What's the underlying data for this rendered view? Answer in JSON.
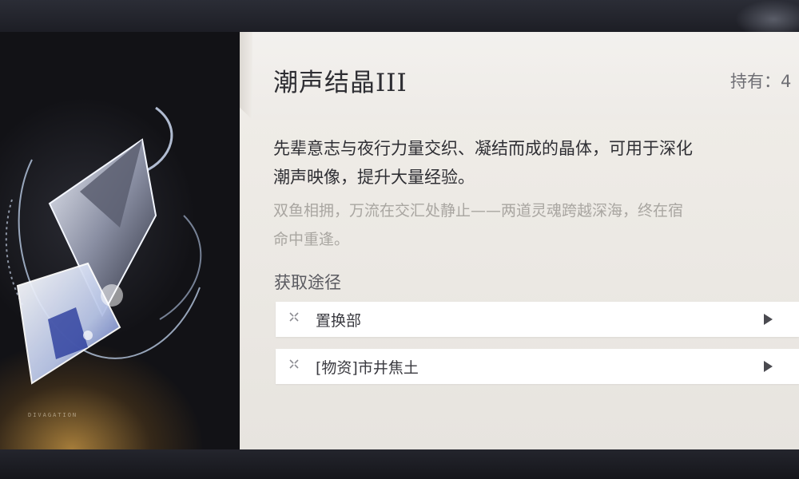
{
  "item": {
    "name": "潮声结晶III",
    "owned_label": "持有：4"
  },
  "description": {
    "line1": "先辈意志与夜行力量交织、凝结而成的晶体，可用于深化",
    "line2": "潮声映像，提升大量经验。"
  },
  "flavor": {
    "line1": "双鱼相拥，万流在交汇处静止——两道灵魂跨越深海，终在宿",
    "line2": "命中重逢。"
  },
  "acquire": {
    "heading": "获取途径",
    "routes": [
      {
        "label": "置换部",
        "icon": "source-marker-icon"
      },
      {
        "label": "[物资]市井焦土",
        "icon": "source-marker-icon"
      }
    ]
  },
  "art": {
    "logo_text": "DIVAGATION"
  },
  "colors": {
    "panel_bg": "#efece8",
    "title_text": "#2e2e33",
    "flavor_text": "#a9a6a1",
    "route_bg": "#ffffff"
  }
}
